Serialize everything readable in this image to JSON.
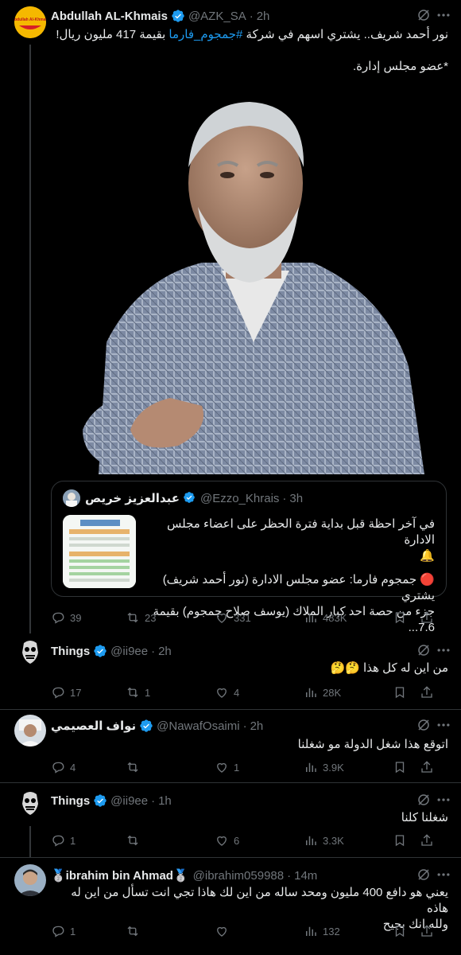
{
  "main_tweet": {
    "name": "Abdullah AL-Khmais",
    "avatar_text": "Abdullah Al-Khmais",
    "handle": "@AZK_SA",
    "time": "2h",
    "text_a": "نور أحمد شريف.. يشتري اسهم في شركة ",
    "hashtag": "#جمجوم_فارما",
    "text_b": " بقيمة 417 مليون ريال!",
    "text_line2": "*عضو مجلس إدارة.",
    "stats": {
      "replies": "39",
      "reposts": "23",
      "likes": "331",
      "views": "483K"
    }
  },
  "quote": {
    "name": "عبدالعزيز خريص",
    "handle": "@Ezzo_Khrais",
    "time": "3h",
    "line1": "في آخر احظة قبل بداية فترة الحظر على اعضاء مجلس الادارة",
    "line2": "🔔",
    "line3": "🔴 جمجوم فارما: عضو مجلس الادارة (نور أحمد شريف) يشتري",
    "line4": "جزء من حصة احد كبار الملاك (يوسف صلاح جمجوم) بقيمة 7.6..."
  },
  "replies": [
    {
      "name": "Things",
      "handle": "@ii9ee",
      "time": "2h",
      "text": "من اين له كل هذا 🤔🤔",
      "replies": "17",
      "reposts": "1",
      "likes": "4",
      "views": "28K"
    },
    {
      "name": "نواف العصيمي",
      "handle": "@NawafOsaimi",
      "time": "2h",
      "text": "اتوقع هذا شغل الدولة مو شغلنا",
      "replies": "4",
      "reposts": "",
      "likes": "1",
      "views": "3.9K"
    },
    {
      "name": "Things",
      "handle": "@ii9ee",
      "time": "1h",
      "text": "شغلنا كلنا",
      "replies": "1",
      "reposts": "",
      "likes": "6",
      "views": "3.3K"
    },
    {
      "name": "🥈ibrahim bin Ahmad🥈",
      "handle": "@ibrahim059988",
      "time": "14m",
      "text1": "يعني هو دافع 400 مليون ومحد ساله من اين لك هاذا تجي انت تسأل من اين له هاذه",
      "text2": "ولله انك بجيح",
      "replies": "1",
      "reposts": "",
      "likes": "",
      "views": "132"
    }
  ],
  "colors": {
    "accent": "#1d9bf0",
    "muted": "#71767b",
    "background": "#000000"
  }
}
